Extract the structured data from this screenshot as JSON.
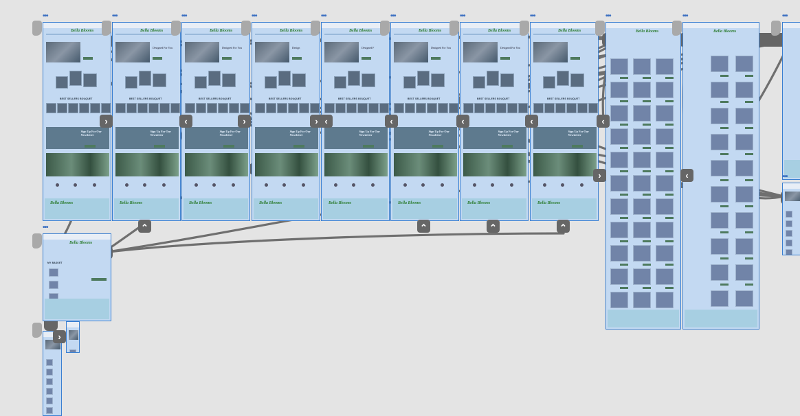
{
  "canvas": {
    "background": "#e4e4e4",
    "frame_border_color": "#3a7fd1",
    "frame_fill_color": "#c3d9f2",
    "connector_color": "#666666"
  },
  "frames": {
    "home_variants": [
      {
        "name": "home-1",
        "logo": "Bella Blooms",
        "hero_title": "",
        "section_heading": "BEST SELLERS BOUQUET",
        "signup_text": "Sign Up For Our Newsletter"
      },
      {
        "name": "home-2",
        "logo": "Bella Blooms",
        "hero_title": "Designed For You",
        "section_heading": "BEST SELLERS BOUQUET",
        "signup_text": "Sign Up For Our Newsletter"
      },
      {
        "name": "home-3",
        "logo": "Bella Blooms",
        "hero_title": "Designed For You",
        "section_heading": "BEST SELLERS BOUQUET",
        "signup_text": "Sign Up For Our Newsletter"
      },
      {
        "name": "home-4",
        "logo": "Bella Blooms",
        "hero_title": "Design",
        "section_heading": "BEST SELLERS BOUQUET",
        "signup_text": "Sign Up For Our Newsletter"
      },
      {
        "name": "home-5",
        "logo": "Bella Blooms",
        "hero_title": "Designed F",
        "section_heading": "BEST SELLERS BOUQUET",
        "signup_text": "Sign Up For Our Newsletter"
      },
      {
        "name": "home-6",
        "logo": "Bella Blooms",
        "hero_title": "Designed For You",
        "section_heading": "BEST SELLERS BOUQUET",
        "signup_text": "Sign Up For Our Newsletter"
      },
      {
        "name": "home-7",
        "logo": "Bella Blooms",
        "hero_title": "Designed For You",
        "section_heading": "BEST SELLERS BOUQUET",
        "signup_text": "Sign Up For Our Newsletter"
      },
      {
        "name": "home-8",
        "logo": "Bella Blooms",
        "hero_title": "",
        "section_heading": "BEST SELLERS BOUQUET",
        "signup_text": "Sign Up For Our Newsletter"
      }
    ],
    "shop_frames": [
      {
        "name": "shop-grid",
        "logo": "Bella Blooms"
      },
      {
        "name": "shop-list",
        "logo": "Bella Blooms"
      }
    ],
    "cart_frame": {
      "name": "cart",
      "logo": "Bella Blooms",
      "title": "MY BASKET"
    },
    "mobile_frames": [
      {
        "name": "mobile-home"
      },
      {
        "name": "mobile-menu"
      }
    ]
  },
  "chevrons": {
    "right": "›",
    "left": "‹",
    "up": "⌃"
  },
  "frame_menu_glyph": "•••"
}
